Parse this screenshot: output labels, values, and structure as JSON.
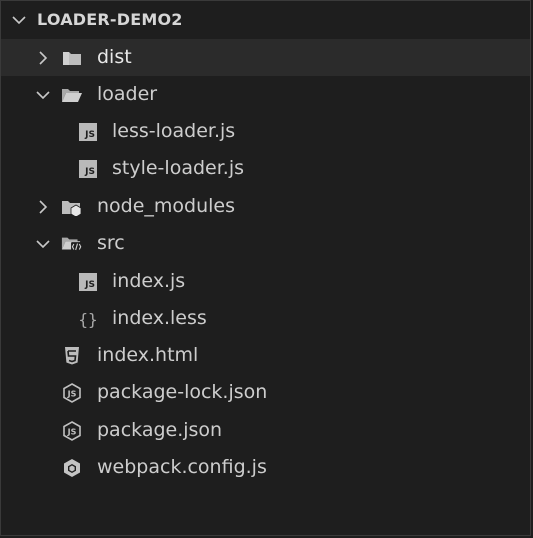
{
  "explorer": {
    "title": "LOADER-DEMO2",
    "expanded": true
  },
  "tree": [
    {
      "label": "dist",
      "kind": "folder",
      "state": "collapsed",
      "icon": "folder-icon",
      "selected": true
    },
    {
      "label": "loader",
      "kind": "folder",
      "state": "expanded",
      "icon": "folder-open-icon"
    },
    {
      "label": "less-loader.js",
      "kind": "file",
      "icon": "javascript-file-icon"
    },
    {
      "label": "style-loader.js",
      "kind": "file",
      "icon": "javascript-file-icon"
    },
    {
      "label": "node_modules",
      "kind": "folder",
      "state": "collapsed",
      "icon": "node-folder-icon"
    },
    {
      "label": "src",
      "kind": "folder",
      "state": "expanded",
      "icon": "src-folder-icon"
    },
    {
      "label": "index.js",
      "kind": "file",
      "icon": "javascript-file-icon"
    },
    {
      "label": "index.less",
      "kind": "file",
      "icon": "less-file-icon"
    },
    {
      "label": "index.html",
      "kind": "file",
      "icon": "html5-file-icon"
    },
    {
      "label": "package-lock.json",
      "kind": "file",
      "icon": "nodejs-file-icon"
    },
    {
      "label": "package.json",
      "kind": "file",
      "icon": "nodejs-file-icon"
    },
    {
      "label": "webpack.config.js",
      "kind": "file",
      "icon": "webpack-file-icon"
    }
  ],
  "icon_badges": {
    "javascript": "JS"
  },
  "colors": {
    "background": "#1e1e1e",
    "selected_row": "#2b2b2b",
    "text": "#cdcdcd",
    "icon": "#b9b9b9"
  }
}
